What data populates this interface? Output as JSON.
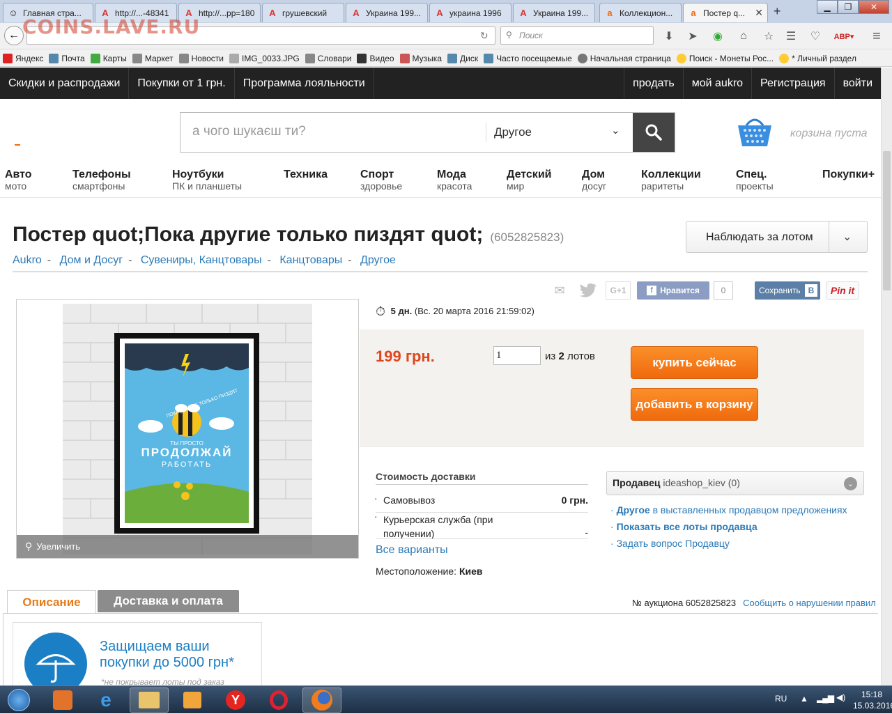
{
  "browser": {
    "tabs": [
      {
        "title": "Главная стра..."
      },
      {
        "title": "http://...-48341"
      },
      {
        "title": "http://...pp=180"
      },
      {
        "title": "грушевский"
      },
      {
        "title": "Украина 199..."
      },
      {
        "title": "украина 1996"
      },
      {
        "title": "Украина 199..."
      },
      {
        "title": "Коллекцион..."
      },
      {
        "title": "Постер q..."
      }
    ],
    "new_tab": "+",
    "search_placeholder": "Поиск",
    "bookmarks": [
      "Яндекс",
      "Почта",
      "Карты",
      "Маркет",
      "Новости",
      "IMG_0033.JPG",
      "Словари",
      "Видео",
      "Музыка",
      "Диск",
      "Часто посещаемые",
      "Начальная страница",
      "Поиск - Монеты Рос...",
      "* Личный раздел"
    ],
    "watermark": "COINS.LAVE.RU"
  },
  "topnav": {
    "left": [
      "Скидки и распродажи",
      "Покупки от 1 грн.",
      "Программа лояльности"
    ],
    "right": [
      "продать",
      "мой aukro",
      "Регистрация",
      "войти"
    ]
  },
  "search": {
    "placeholder": "а чого шукаєш ти?",
    "category": "Другое"
  },
  "cart": {
    "label": "корзина пуста"
  },
  "categories": [
    {
      "main": "Авто",
      "sub": "мото"
    },
    {
      "main": "Телефоны",
      "sub": "смартфоны"
    },
    {
      "main": "Ноутбуки",
      "sub": "ПК и планшеты"
    },
    {
      "main": "Техника",
      "sub": ""
    },
    {
      "main": "Спорт",
      "sub": "здоровье"
    },
    {
      "main": "Мода",
      "sub": "красота"
    },
    {
      "main": "Детский",
      "sub": "мир"
    },
    {
      "main": "Дом",
      "sub": "досуг"
    },
    {
      "main": "Коллекции",
      "sub": "раритеты"
    },
    {
      "main": "Спец.",
      "sub": "проекты"
    },
    {
      "main": "Покупки+",
      "sub": ""
    }
  ],
  "listing": {
    "title": "Постер quot;Пока другие только пиздят quot;",
    "id": "(6052825823)",
    "breadcrumbs": [
      "Aukro",
      "Дом и Досуг",
      "Сувениры, Канцтовары",
      "Канцтовары",
      "Другое"
    ],
    "watch_label": "Наблюдать за лотом",
    "social": {
      "like": "Нравится",
      "like_count": "0",
      "save": "Сохранить",
      "save_badge": "B",
      "pin": "Pin it"
    },
    "zoom_label": "Увеличить",
    "time_left": "5 дн.",
    "end_date": "(Вс. 20 марта 2016 21:59:02)",
    "price": "199 грн.",
    "quantity": "1",
    "of_prefix": "из",
    "of_count": "2",
    "of_suffix": "лотов",
    "buy_now": "купить сейчас",
    "add_to_cart": "добавить в корзину"
  },
  "shipping": {
    "title": "Стоимость доставки",
    "rows": [
      {
        "name": "Самовывоз",
        "price": "0 грн."
      },
      {
        "name": "Курьерская служба (при получении)",
        "price": "-"
      }
    ],
    "all_variants": "Все варианты",
    "location_label": "Местоположение:",
    "location": "Киев"
  },
  "seller": {
    "label": "Продавец",
    "name": "ideashop_kiev (0)",
    "links": [
      {
        "bold": "Другое",
        "rest": " в выставленных продавцом предложениях"
      },
      {
        "bold": "Показать все лоты продавца",
        "rest": ""
      },
      {
        "bold": "",
        "rest": "Задать вопрос Продавцу"
      }
    ]
  },
  "tabs": {
    "description": "Описание",
    "delivery": "Доставка и оплата",
    "auction_no": "№ аукциона 6052825823",
    "report": "Сообщить о нарушении правил"
  },
  "protect": {
    "line1": "Защищаем ваши",
    "line2": "покупки до 5000 грн*",
    "note": "*не покрывает лоты под заказ"
  },
  "poster": {
    "line1": "ПОКА ДРУГИЕ ТОЛЬКО ПИЗДЯТ",
    "line2": "ТЫ ПРОСТО",
    "line3": "ПРОДОЛЖАЙ",
    "line4": "РАБОТАТЬ"
  },
  "taskbar": {
    "lang": "RU",
    "time": "15:18",
    "date": "15.03.2016"
  },
  "colors": {
    "accent": "#f06a0c",
    "link": "#2a7ab8",
    "price": "#e0461e",
    "nav_bg": "#222222"
  }
}
